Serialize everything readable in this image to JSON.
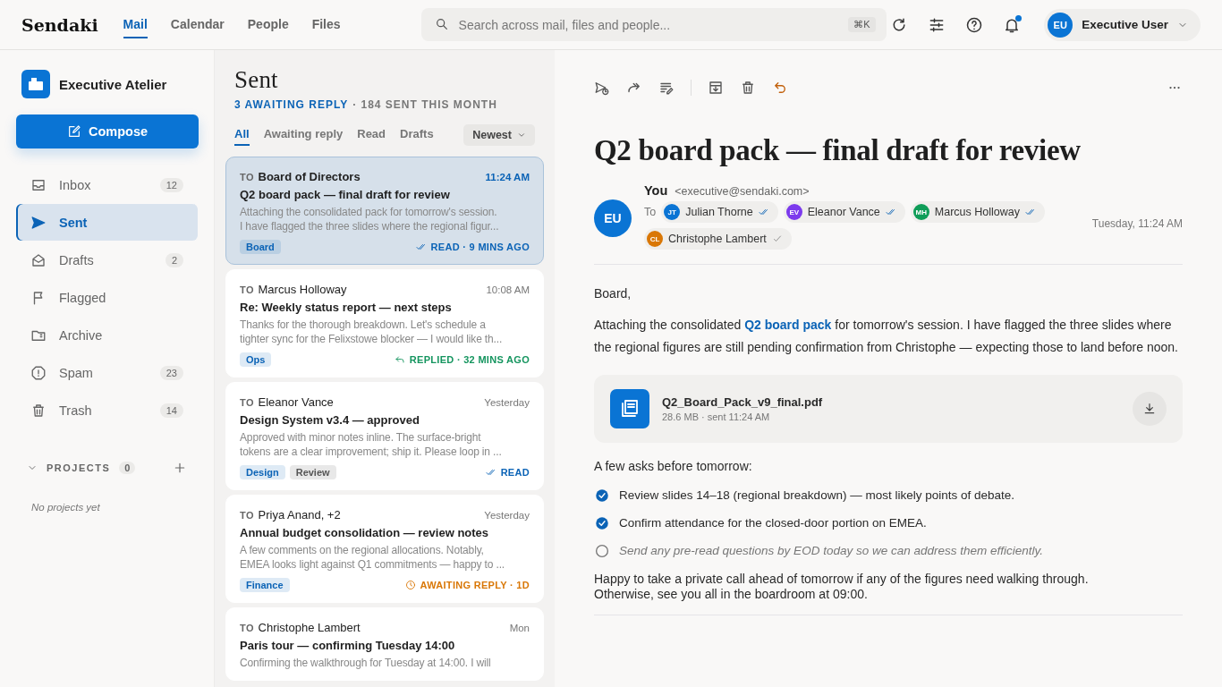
{
  "app": {
    "logo": "Sendaki"
  },
  "nav": [
    {
      "label": "Mail",
      "selected": true
    },
    {
      "label": "Calendar",
      "selected": false
    },
    {
      "label": "People",
      "selected": false
    },
    {
      "label": "Files",
      "selected": false
    }
  ],
  "search": {
    "placeholder": "Search across mail, files and people...",
    "shortcut": "⌘K"
  },
  "notifications": {
    "unread": true
  },
  "user": {
    "initials": "EU",
    "name": "Executive User"
  },
  "workspace": {
    "name": "Executive Atelier"
  },
  "compose": "Compose",
  "folders": [
    {
      "label": "Inbox",
      "count": "12",
      "selected": false
    },
    {
      "label": "Sent",
      "selected": true
    },
    {
      "label": "Drafts",
      "count": "2",
      "selected": false
    },
    {
      "label": "Flagged",
      "selected": false
    },
    {
      "label": "Archive",
      "selected": false
    },
    {
      "label": "Spam",
      "count": "23",
      "selected": false
    },
    {
      "label": "Trash",
      "count": "14",
      "selected": false
    }
  ],
  "projects": {
    "label": "PROJECTS",
    "count": "0",
    "expanded": true,
    "empty": "No projects yet"
  },
  "list": {
    "title": "Sent",
    "awaiting": "3 AWAITING REPLY",
    "summary": "· 184 SENT THIS MONTH",
    "filters": [
      {
        "label": "All",
        "selected": true
      },
      {
        "label": "Awaiting reply",
        "selected": false
      },
      {
        "label": "Read",
        "selected": false
      },
      {
        "label": "Drafts",
        "selected": false
      }
    ],
    "sort": "Newest",
    "messages": [
      {
        "to_label": "TO",
        "to": "Board of Directors",
        "time": "11:24 AM",
        "subject": "Q2 board pack — final draft for review",
        "preview": [
          "Attaching the consolidated pack for tomorrow's session.",
          "I have flagged the three slides where the regional figur..."
        ],
        "tags": [
          {
            "label": "Board",
            "color": "#0b63b6"
          }
        ],
        "status": {
          "kind": "read",
          "text": "READ · 9 MINS AGO"
        },
        "selected": true
      },
      {
        "to_label": "TO",
        "to": "Marcus Holloway",
        "time": "10:08 AM",
        "subject": "Re: Weekly status report — next steps",
        "preview": [
          "Thanks for the thorough breakdown. Let's schedule a",
          "tighter sync for the Felixstowe blocker — I would like th..."
        ],
        "tags": [
          {
            "label": "Ops",
            "color": "#0b63b6"
          }
        ],
        "status": {
          "kind": "replied",
          "text": "REPLIED · 32 MINS AGO"
        },
        "selected": false
      },
      {
        "to_label": "TO",
        "to": "Eleanor Vance",
        "time": "Yesterday",
        "subject": "Design System v3.4 — approved",
        "preview": [
          "Approved with minor notes inline. The surface-bright",
          "tokens are a clear improvement; ship it. Please loop in ..."
        ],
        "tags": [
          {
            "label": "Design",
            "color": "#0b63b6"
          },
          {
            "label": "Review",
            "color": "#555555"
          }
        ],
        "status": {
          "kind": "read",
          "text": "READ"
        },
        "selected": false
      },
      {
        "to_label": "TO",
        "to": "Priya Anand, +2",
        "time": "Yesterday",
        "subject": "Annual budget consolidation — review notes",
        "preview": [
          "A few comments on the regional allocations. Notably,",
          "EMEA looks light against Q1 commitments — happy to ..."
        ],
        "tags": [
          {
            "label": "Finance",
            "color": "#0b63b6"
          }
        ],
        "status": {
          "kind": "awaiting",
          "text": "AWAITING REPLY · 1D"
        },
        "selected": false
      },
      {
        "to_label": "TO",
        "to": "Christophe Lambert",
        "time": "Mon",
        "subject": "Paris tour — confirming Tuesday 14:00",
        "preview": [
          "Confirming the walkthrough for Tuesday at 14:00. I will"
        ],
        "selected": false
      }
    ]
  },
  "message": {
    "subject": "Q2 board pack — final draft for review",
    "sender": {
      "initials": "EU",
      "name": "You",
      "email": "<executive@sendaki.com>"
    },
    "to_label": "To",
    "date": "Tuesday, 11:24 AM",
    "recipients": [
      {
        "initials": "JT",
        "name": "Julian Thorne",
        "color": "#0a74d4",
        "read": true
      },
      {
        "initials": "EV",
        "name": "Eleanor Vance",
        "color": "#7c3aed",
        "read": true
      },
      {
        "initials": "MH",
        "name": "Marcus Holloway",
        "color": "#0f9d58",
        "read": true
      },
      {
        "initials": "CL",
        "name": "Christophe Lambert",
        "color": "#d97706",
        "read": false
      }
    ],
    "greeting": "Board,",
    "intro": "Attaching the consolidated **Q2 board pack** for tomorrow's session. I have flagged the three slides where the regional figures are still pending confirmation from Christophe — expecting those to land before noon.",
    "attachment": {
      "name": "Q2_Board_Pack_v9_final.pdf",
      "meta": "28.6 MB · sent 11:24 AM"
    },
    "asks_title": "A few asks before tomorrow:",
    "asks": [
      {
        "text": "Review slides 14–18 (regional breakdown) — most likely points of debate.",
        "checked": true
      },
      {
        "text": "Confirm attendance for the closed-door portion on EMEA.",
        "checked": true
      },
      {
        "text": "Send any pre-read questions by EOD today so we can address them efficiently.",
        "checked": false
      }
    ],
    "closing": [
      "Happy to take a private call ahead of tomorrow if any of the figures need walking through.",
      "Otherwise, see you all in the boardroom at 09:00."
    ]
  }
}
